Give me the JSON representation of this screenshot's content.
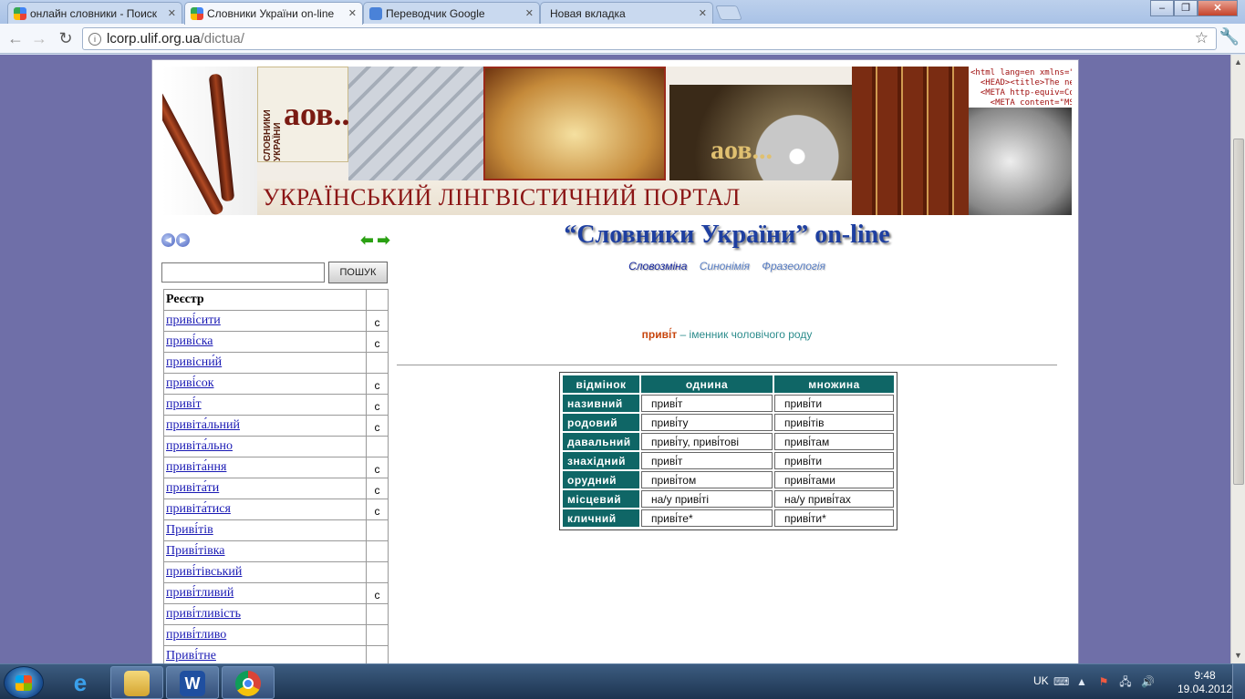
{
  "browser": {
    "tabs": [
      {
        "label": "онлайн словники - Поиск",
        "active": false
      },
      {
        "label": "Словники України on-line",
        "active": true
      },
      {
        "label": "Переводчик Google",
        "active": false
      },
      {
        "label": "Новая вкладка",
        "active": false
      }
    ],
    "address": {
      "host": "lcorp.ulif.org.ua",
      "path": "/dictua/"
    }
  },
  "banner": {
    "title": "УКРАЇНСЬКИЙ ЛІНГВІСТИЧНИЙ ПОРТАЛ",
    "logo_text": "аов...",
    "logo_vertical": "СЛОВНИКИ УКРАЇНИ",
    "code_snippet": "<html lang=en xmlns=\"http:\n  <HEAD><title>The new pr\n  <META http-equiv=Conte\n    <META content=\"MSHT"
  },
  "sidebar": {
    "search_placeholder": "",
    "search_button": "ПОШУК",
    "registry_header": "Реєстр",
    "entries": [
      {
        "word": "приві́сити",
        "flag": "с"
      },
      {
        "word": "приві́ска",
        "flag": "с"
      },
      {
        "word": "привісни́й",
        "flag": ""
      },
      {
        "word": "приві́сок",
        "flag": "с"
      },
      {
        "word": "приві́т",
        "flag": "с"
      },
      {
        "word": "привіта́льний",
        "flag": "с"
      },
      {
        "word": "привіта́льно",
        "flag": ""
      },
      {
        "word": "привіта́ння",
        "flag": "с"
      },
      {
        "word": "привіта́ти",
        "flag": "с"
      },
      {
        "word": "привіта́тися",
        "flag": "с"
      },
      {
        "word": "Приві́тів",
        "flag": ""
      },
      {
        "word": "Приві́тівка",
        "flag": ""
      },
      {
        "word": "приві́тівський",
        "flag": ""
      },
      {
        "word": "приві́тливий",
        "flag": "с"
      },
      {
        "word": "приві́тливість",
        "flag": ""
      },
      {
        "word": "приві́тливо",
        "flag": ""
      },
      {
        "word": "Приві́тне",
        "flag": ""
      }
    ]
  },
  "main": {
    "title": "“Словники України” on-line",
    "subnav": [
      {
        "label": "Словозміна",
        "active": true
      },
      {
        "label": "Синонімія",
        "active": false
      },
      {
        "label": "Фразеологія",
        "active": false
      }
    ],
    "headword": "приві́т",
    "description": " – іменник чоловічого роду",
    "table": {
      "headers": [
        "відмінок",
        "однина",
        "множина"
      ],
      "rows": [
        {
          "case": "називний",
          "sg": "приві́т",
          "pl": "приві́ти"
        },
        {
          "case": "родовий",
          "sg": "приві́ту",
          "pl": "приві́тів"
        },
        {
          "case": "давальний",
          "sg": "приві́ту, приві́тові",
          "pl": "приві́там"
        },
        {
          "case": "знахідний",
          "sg": "приві́т",
          "pl": "приві́ти"
        },
        {
          "case": "орудний",
          "sg": "приві́том",
          "pl": "приві́тами"
        },
        {
          "case": "місцевий",
          "sg": "на/у приві́ті",
          "pl": "на/у приві́тах"
        },
        {
          "case": "кличний",
          "sg": "приві́те*",
          "pl": "приві́ти*"
        }
      ]
    }
  },
  "taskbar": {
    "lang": "UK",
    "time": "9:48",
    "date": "19.04.2012"
  }
}
